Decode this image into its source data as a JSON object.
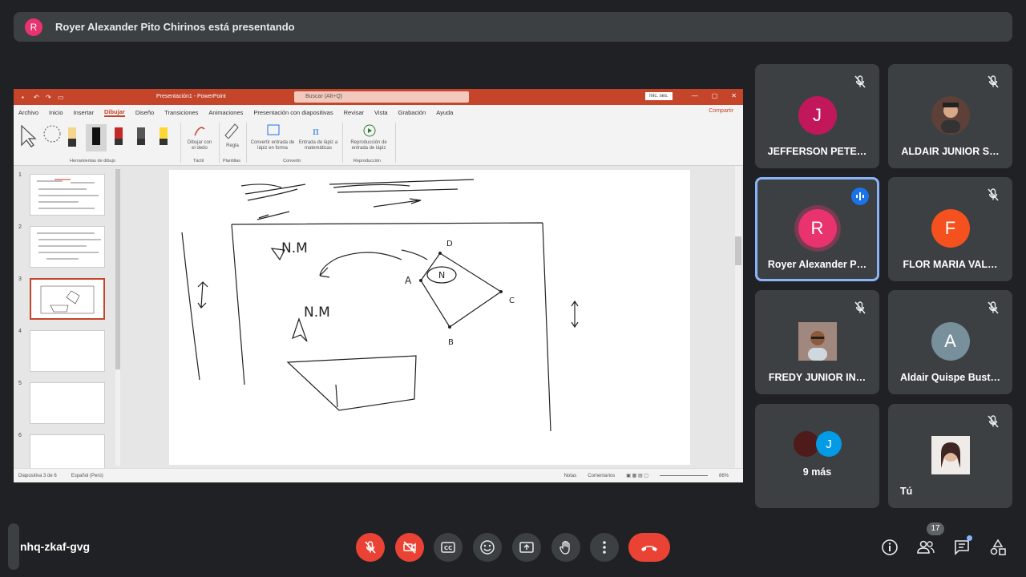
{
  "presenter_banner": {
    "initial": "R",
    "text": "Royer Alexander Pito Chirinos está presentando"
  },
  "powerpoint": {
    "doc_title": "Presentación1 - PowerPoint",
    "search_placeholder": "Buscar (Alt+Q)",
    "signin": "Inic. ses.",
    "menu": [
      "Archivo",
      "Inicio",
      "Insertar",
      "Dibujar",
      "Diseño",
      "Transiciones",
      "Animaciones",
      "Presentación con diapositivas",
      "Revisar",
      "Vista",
      "Grabación",
      "Ayuda"
    ],
    "active_menu": "Dibujar",
    "share": "Compartir",
    "ribbon": {
      "drawing_tools_label": "Herramientas de dibujo",
      "draw_finger": "Dibujar con el dedo",
      "ruler": "Regla",
      "touch_label": "Táctil",
      "stencils_label": "Plantillas",
      "convert_shape": "Convertir entrada de lápiz en forma",
      "ink_math": "Entrada de lápiz a matemáticas",
      "convert_label": "Convertir",
      "replay": "Reproducción de entrada de lápiz",
      "replay_label": "Reproducción"
    },
    "slides": [
      "1",
      "2",
      "3",
      "4",
      "5",
      "6"
    ],
    "selected_slide": "3",
    "slide_labels": {
      "nm1": "N.M",
      "nm2": "N.M",
      "n": "N",
      "a": "A",
      "b": "B",
      "c": "C",
      "d": "D"
    },
    "status": {
      "slide": "Diapositiva 3 de 6",
      "lang": "Español (Perú)",
      "notes": "Notas",
      "comments": "Comentarios",
      "zoom": "86%"
    }
  },
  "participants": [
    {
      "name": "JEFFERSON PETE…",
      "initial": "J",
      "color": "#c2185b",
      "muted": true
    },
    {
      "name": "ALDAIR JUNIOR S…",
      "initial": "",
      "color": "#6d4c41",
      "muted": true,
      "photo": true
    },
    {
      "name": "Royer Alexander P…",
      "initial": "R",
      "color": "#e8336f",
      "muted": false,
      "speaking": true
    },
    {
      "name": "FLOR MARIA VAL…",
      "initial": "F",
      "color": "#f4511e",
      "muted": true
    },
    {
      "name": "FREDY JUNIOR IN…",
      "initial": "",
      "color": "#8d6e63",
      "muted": true,
      "photo": true
    },
    {
      "name": "Aldair Quispe Bust…",
      "initial": "A",
      "color": "#78909c",
      "muted": true
    },
    {
      "name": "9 más",
      "initial": "J",
      "color": "#039be5",
      "muted": false
    },
    {
      "name": "Tú",
      "initial": "",
      "color": "#bcaaa4",
      "muted": true,
      "photo": true
    }
  ],
  "meeting_code": "nhq-zkaf-gvg",
  "people_count": "17",
  "colors": {
    "end_call": "#ea4335",
    "accent": "#8ab4f8",
    "ppt_brand": "#c4452a"
  }
}
